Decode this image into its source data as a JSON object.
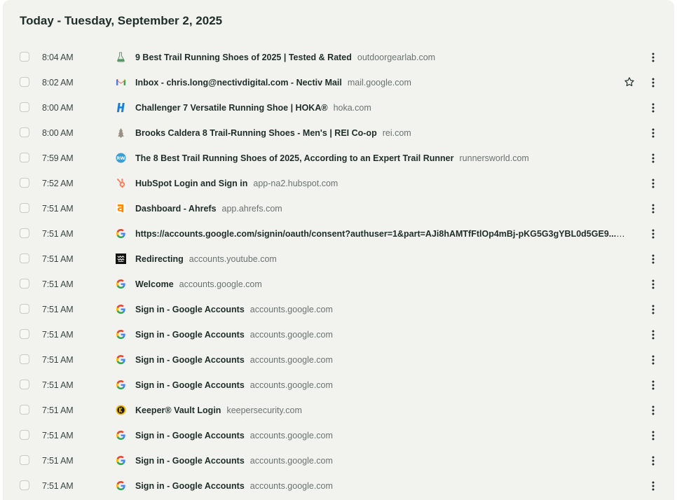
{
  "history": {
    "heading": "Today - Tuesday, September 2, 2025",
    "rows": [
      {
        "time": "8:04 AM",
        "title": "9 Best Trail Running Shoes of 2025 | Tested & Rated",
        "domain": "outdoorgearlab.com",
        "icon": "outdoorgearlab-icon",
        "starred": false
      },
      {
        "time": "8:02 AM",
        "title": "Inbox - chris.long@nectivdigital.com - Nectiv Mail",
        "domain": "mail.google.com",
        "icon": "gmail-icon",
        "starred": true
      },
      {
        "time": "8:00 AM",
        "title": "Challenger 7 Versatile Running Shoe | HOKA®",
        "domain": "hoka.com",
        "icon": "hoka-icon",
        "starred": false
      },
      {
        "time": "8:00 AM",
        "title": "Brooks Caldera 8 Trail-Running Shoes - Men's | REI Co-op",
        "domain": "rei.com",
        "icon": "rei-icon",
        "starred": false
      },
      {
        "time": "7:59 AM",
        "title": "The 8 Best Trail Running Shoes of 2025, According to an Expert Trail Runner",
        "domain": "runnersworld.com",
        "icon": "runnersworld-icon",
        "starred": false
      },
      {
        "time": "7:52 AM",
        "title": "HubSpot Login and Sign in",
        "domain": "app-na2.hubspot.com",
        "icon": "hubspot-icon",
        "starred": false
      },
      {
        "time": "7:51 AM",
        "title": "Dashboard - Ahrefs",
        "domain": "app.ahrefs.com",
        "icon": "ahrefs-icon",
        "starred": false
      },
      {
        "time": "7:51 AM",
        "title": "https://accounts.google.com/signin/oauth/consent?authuser=1&part=AJi8hAMTfFtlOp4mBj-pKG5G3gYBL0d5GE9...",
        "domain": "accounts.google.com",
        "icon": "google-icon",
        "starred": false
      },
      {
        "time": "7:51 AM",
        "title": "Redirecting",
        "domain": "accounts.youtube.com",
        "icon": "youtube-accounts-icon",
        "starred": false
      },
      {
        "time": "7:51 AM",
        "title": "Welcome",
        "domain": "accounts.google.com",
        "icon": "google-icon",
        "starred": false
      },
      {
        "time": "7:51 AM",
        "title": "Sign in - Google Accounts",
        "domain": "accounts.google.com",
        "icon": "google-icon",
        "starred": false
      },
      {
        "time": "7:51 AM",
        "title": "Sign in - Google Accounts",
        "domain": "accounts.google.com",
        "icon": "google-icon",
        "starred": false
      },
      {
        "time": "7:51 AM",
        "title": "Sign in - Google Accounts",
        "domain": "accounts.google.com",
        "icon": "google-icon",
        "starred": false
      },
      {
        "time": "7:51 AM",
        "title": "Sign in - Google Accounts",
        "domain": "accounts.google.com",
        "icon": "google-icon",
        "starred": false
      },
      {
        "time": "7:51 AM",
        "title": "Keeper® Vault Login",
        "domain": "keepersecurity.com",
        "icon": "keeper-icon",
        "starred": false
      },
      {
        "time": "7:51 AM",
        "title": "Sign in - Google Accounts",
        "domain": "accounts.google.com",
        "icon": "google-icon",
        "starred": false
      },
      {
        "time": "7:51 AM",
        "title": "Sign in - Google Accounts",
        "domain": "accounts.google.com",
        "icon": "google-icon",
        "starred": false
      },
      {
        "time": "7:51 AM",
        "title": "Sign in - Google Accounts",
        "domain": "accounts.google.com",
        "icon": "google-icon",
        "starred": false
      }
    ]
  },
  "colors": {
    "panel_bg": "#f2f3ee",
    "text": "#1f2d2a",
    "muted": "#6a7270"
  }
}
